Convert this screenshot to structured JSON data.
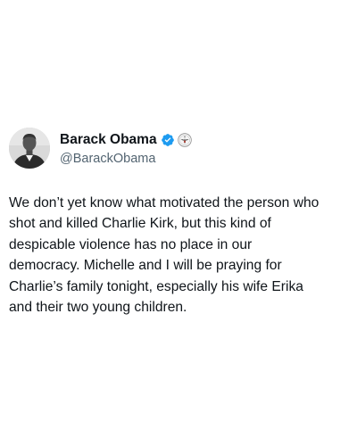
{
  "author": {
    "display_name": "Barack Obama",
    "handle": "@BarackObama",
    "avatar_icon": "profile-photo-avatar",
    "verified_icon": "verified-badge-icon",
    "affiliation_icon": "government-seal-icon",
    "verified_color": "#1d9bf0"
  },
  "tweet": {
    "lines": [
      "We don’t yet know what motivated the person who",
      "shot and killed Charlie Kirk, but this kind of",
      "despicable violence has no place in our",
      "democracy. Michelle and I will be praying for",
      "Charlie’s family tonight, especially his wife Erika",
      "and their two young children."
    ]
  }
}
